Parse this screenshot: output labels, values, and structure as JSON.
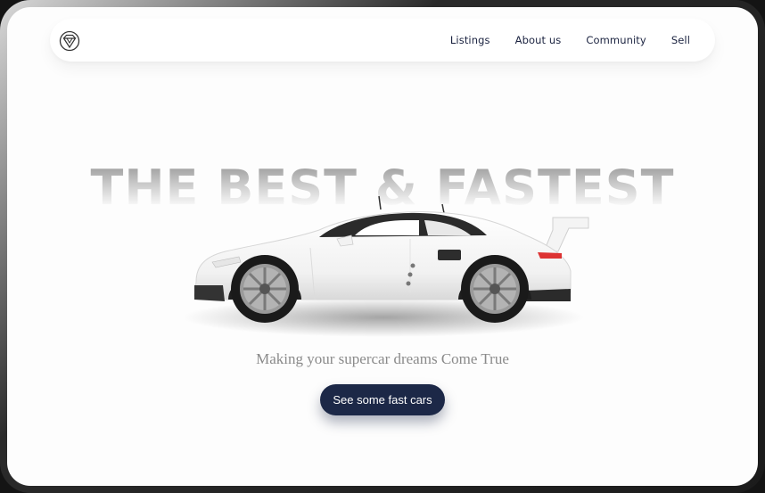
{
  "nav": {
    "logo_icon": "diamond-shield-logo-icon",
    "links": [
      "Listings",
      "About us",
      "Community",
      "Sell"
    ]
  },
  "hero": {
    "headline": "THE BEST & FASTEST",
    "tagline": "Making your supercar dreams Come True",
    "cta_label": "See some fast cars"
  },
  "colors": {
    "primary": "#1c2847",
    "nav_text": "#1b2340",
    "tagline": "#8a8a8a",
    "background": "#fdfdfd"
  }
}
